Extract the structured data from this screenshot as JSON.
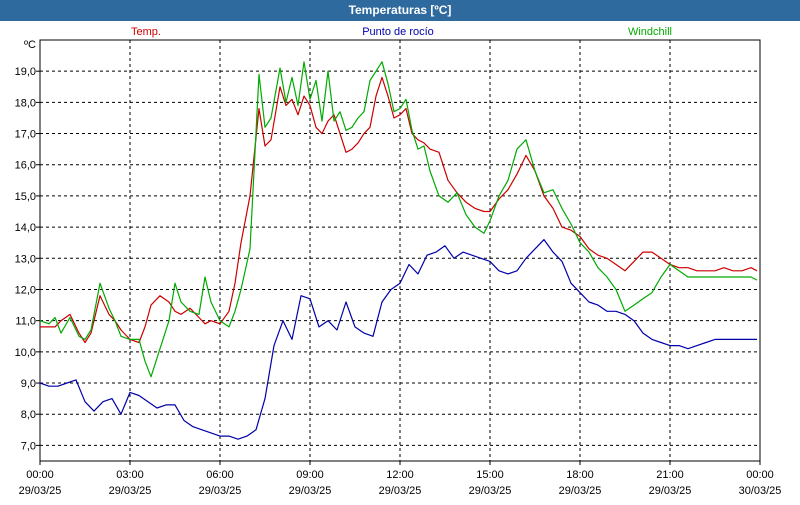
{
  "window": {
    "title": "Temperaturas [ºC]"
  },
  "chart_data": {
    "type": "line",
    "title": "Temperaturas [ºC]",
    "ylabel": "ºC",
    "ylim": [
      6.5,
      20.0
    ],
    "yticks": [
      "7,0",
      "8,0",
      "9,0",
      "10,0",
      "11,0",
      "12,0",
      "13,0",
      "14,0",
      "15,0",
      "16,0",
      "17,0",
      "18,0",
      "19,0"
    ],
    "xticks": [
      {
        "time": "00:00",
        "date": "29/03/25"
      },
      {
        "time": "03:00",
        "date": "29/03/25"
      },
      {
        "time": "06:00",
        "date": "29/03/25"
      },
      {
        "time": "09:00",
        "date": "29/03/25"
      },
      {
        "time": "12:00",
        "date": "29/03/25"
      },
      {
        "time": "15:00",
        "date": "29/03/25"
      },
      {
        "time": "18:00",
        "date": "29/03/25"
      },
      {
        "time": "21:00",
        "date": "29/03/25"
      },
      {
        "time": "00:00",
        "date": "30/03/25"
      }
    ],
    "grid": true,
    "legend_position": "top",
    "series": [
      {
        "name": "Temp.",
        "color": "#cc0000",
        "x": [
          0.0,
          0.3,
          0.5,
          0.7,
          1.0,
          1.3,
          1.5,
          1.7,
          2.0,
          2.3,
          2.5,
          2.7,
          3.0,
          3.3,
          3.5,
          3.7,
          4.0,
          4.3,
          4.5,
          4.7,
          5.0,
          5.3,
          5.5,
          5.7,
          6.0,
          6.3,
          6.5,
          6.7,
          7.0,
          7.3,
          7.5,
          7.7,
          8.0,
          8.2,
          8.4,
          8.6,
          8.8,
          9.0,
          9.2,
          9.4,
          9.6,
          9.8,
          10.0,
          10.2,
          10.4,
          10.6,
          10.8,
          11.0,
          11.2,
          11.4,
          11.6,
          11.8,
          12.0,
          12.2,
          12.4,
          12.6,
          12.8,
          13.0,
          13.3,
          13.6,
          13.9,
          14.2,
          14.5,
          14.8,
          15.0,
          15.3,
          15.6,
          15.9,
          16.2,
          16.5,
          16.8,
          17.1,
          17.4,
          17.7,
          18.0,
          18.3,
          18.6,
          18.9,
          19.2,
          19.5,
          19.8,
          20.1,
          20.4,
          20.7,
          21.0,
          21.3,
          21.6,
          21.9,
          22.2,
          22.5,
          22.8,
          23.1,
          23.4,
          23.7,
          23.9
        ],
        "values": [
          10.8,
          10.8,
          10.8,
          11.0,
          11.2,
          10.6,
          10.3,
          10.6,
          11.8,
          11.2,
          11.0,
          10.7,
          10.4,
          10.3,
          10.8,
          11.5,
          11.8,
          11.6,
          11.3,
          11.2,
          11.4,
          11.1,
          10.9,
          11.0,
          10.9,
          11.3,
          12.2,
          13.5,
          15.0,
          17.8,
          16.6,
          16.8,
          18.5,
          17.9,
          18.1,
          17.6,
          18.2,
          17.9,
          17.2,
          17.0,
          17.4,
          17.6,
          17.0,
          16.4,
          16.5,
          16.7,
          17.0,
          17.2,
          18.2,
          18.8,
          18.2,
          17.5,
          17.6,
          17.8,
          17.0,
          16.8,
          16.7,
          16.5,
          16.4,
          15.5,
          15.1,
          14.8,
          14.6,
          14.5,
          14.5,
          14.9,
          15.2,
          15.7,
          16.3,
          15.8,
          15.0,
          14.6,
          14.0,
          13.9,
          13.7,
          13.3,
          13.1,
          13.0,
          12.8,
          12.6,
          12.9,
          13.2,
          13.2,
          13.0,
          12.8,
          12.7,
          12.7,
          12.6,
          12.6,
          12.6,
          12.7,
          12.6,
          12.6,
          12.7,
          12.6
        ]
      },
      {
        "name": "Punto de rocío",
        "color": "#0000aa",
        "x": [
          0.0,
          0.3,
          0.6,
          0.9,
          1.2,
          1.5,
          1.8,
          2.1,
          2.4,
          2.7,
          3.0,
          3.3,
          3.6,
          3.9,
          4.2,
          4.5,
          4.8,
          5.1,
          5.4,
          5.7,
          6.0,
          6.3,
          6.6,
          6.9,
          7.2,
          7.5,
          7.8,
          8.1,
          8.4,
          8.7,
          9.0,
          9.3,
          9.6,
          9.9,
          10.2,
          10.5,
          10.8,
          11.1,
          11.4,
          11.7,
          12.0,
          12.3,
          12.6,
          12.9,
          13.2,
          13.5,
          13.8,
          14.1,
          14.4,
          14.7,
          15.0,
          15.3,
          15.6,
          15.9,
          16.2,
          16.5,
          16.8,
          17.1,
          17.4,
          17.7,
          18.0,
          18.3,
          18.6,
          18.9,
          19.2,
          19.5,
          19.8,
          20.1,
          20.4,
          20.7,
          21.0,
          21.3,
          21.6,
          21.9,
          22.2,
          22.5,
          22.8,
          23.1,
          23.4,
          23.7,
          23.9
        ],
        "values": [
          9.0,
          8.9,
          8.9,
          9.0,
          9.1,
          8.4,
          8.1,
          8.4,
          8.5,
          8.0,
          8.7,
          8.6,
          8.4,
          8.2,
          8.3,
          8.3,
          7.8,
          7.6,
          7.5,
          7.4,
          7.3,
          7.3,
          7.2,
          7.3,
          7.5,
          8.5,
          10.2,
          11.0,
          10.4,
          11.8,
          11.7,
          10.8,
          11.0,
          10.7,
          11.6,
          10.8,
          10.6,
          10.5,
          11.6,
          12.0,
          12.2,
          12.8,
          12.5,
          13.1,
          13.2,
          13.4,
          13.0,
          13.2,
          13.1,
          13.0,
          12.9,
          12.6,
          12.5,
          12.6,
          13.0,
          13.3,
          13.6,
          13.2,
          12.9,
          12.2,
          11.9,
          11.6,
          11.5,
          11.3,
          11.3,
          11.2,
          11.0,
          10.6,
          10.4,
          10.3,
          10.2,
          10.2,
          10.1,
          10.2,
          10.3,
          10.4,
          10.4,
          10.4,
          10.4,
          10.4,
          10.4
        ]
      },
      {
        "name": "Windchill",
        "color": "#00aa00",
        "x": [
          0.0,
          0.3,
          0.5,
          0.7,
          1.0,
          1.3,
          1.5,
          1.7,
          2.0,
          2.3,
          2.5,
          2.7,
          3.0,
          3.3,
          3.5,
          3.7,
          4.0,
          4.3,
          4.5,
          4.7,
          5.0,
          5.3,
          5.5,
          5.7,
          6.0,
          6.3,
          6.5,
          6.7,
          7.0,
          7.3,
          7.5,
          7.7,
          8.0,
          8.2,
          8.4,
          8.6,
          8.8,
          9.0,
          9.2,
          9.4,
          9.6,
          9.8,
          10.0,
          10.2,
          10.4,
          10.6,
          10.8,
          11.0,
          11.2,
          11.4,
          11.6,
          11.8,
          12.0,
          12.2,
          12.4,
          12.6,
          12.8,
          13.0,
          13.3,
          13.6,
          13.9,
          14.2,
          14.5,
          14.8,
          15.0,
          15.3,
          15.6,
          15.9,
          16.2,
          16.5,
          16.8,
          17.1,
          17.4,
          17.7,
          18.0,
          18.3,
          18.6,
          18.9,
          19.2,
          19.5,
          19.8,
          20.1,
          20.4,
          20.7,
          21.0,
          21.3,
          21.6,
          21.9,
          22.2,
          22.5,
          22.8,
          23.1,
          23.4,
          23.7,
          23.9
        ],
        "values": [
          11.0,
          10.9,
          11.1,
          10.6,
          11.1,
          10.5,
          10.4,
          10.7,
          12.2,
          11.4,
          11.0,
          10.5,
          10.4,
          10.4,
          9.7,
          9.2,
          10.1,
          11.0,
          12.2,
          11.6,
          11.3,
          11.2,
          12.4,
          11.6,
          11.0,
          10.8,
          11.3,
          12.0,
          13.3,
          18.9,
          17.2,
          17.5,
          19.1,
          18.0,
          18.8,
          17.9,
          19.3,
          18.1,
          18.7,
          17.4,
          19.0,
          17.4,
          17.7,
          17.1,
          17.2,
          17.5,
          17.7,
          18.7,
          19.0,
          19.3,
          18.6,
          17.7,
          17.8,
          18.1,
          17.1,
          16.5,
          16.6,
          15.8,
          15.0,
          14.8,
          15.1,
          14.4,
          14.0,
          13.8,
          14.2,
          15.0,
          15.5,
          16.5,
          16.8,
          15.8,
          15.1,
          15.2,
          14.6,
          14.1,
          13.5,
          13.2,
          12.7,
          12.4,
          12.0,
          11.3,
          11.5,
          11.7,
          11.9,
          12.4,
          12.8,
          12.6,
          12.4,
          12.4,
          12.4,
          12.4,
          12.4,
          12.4,
          12.4,
          12.4,
          12.3
        ]
      }
    ]
  }
}
